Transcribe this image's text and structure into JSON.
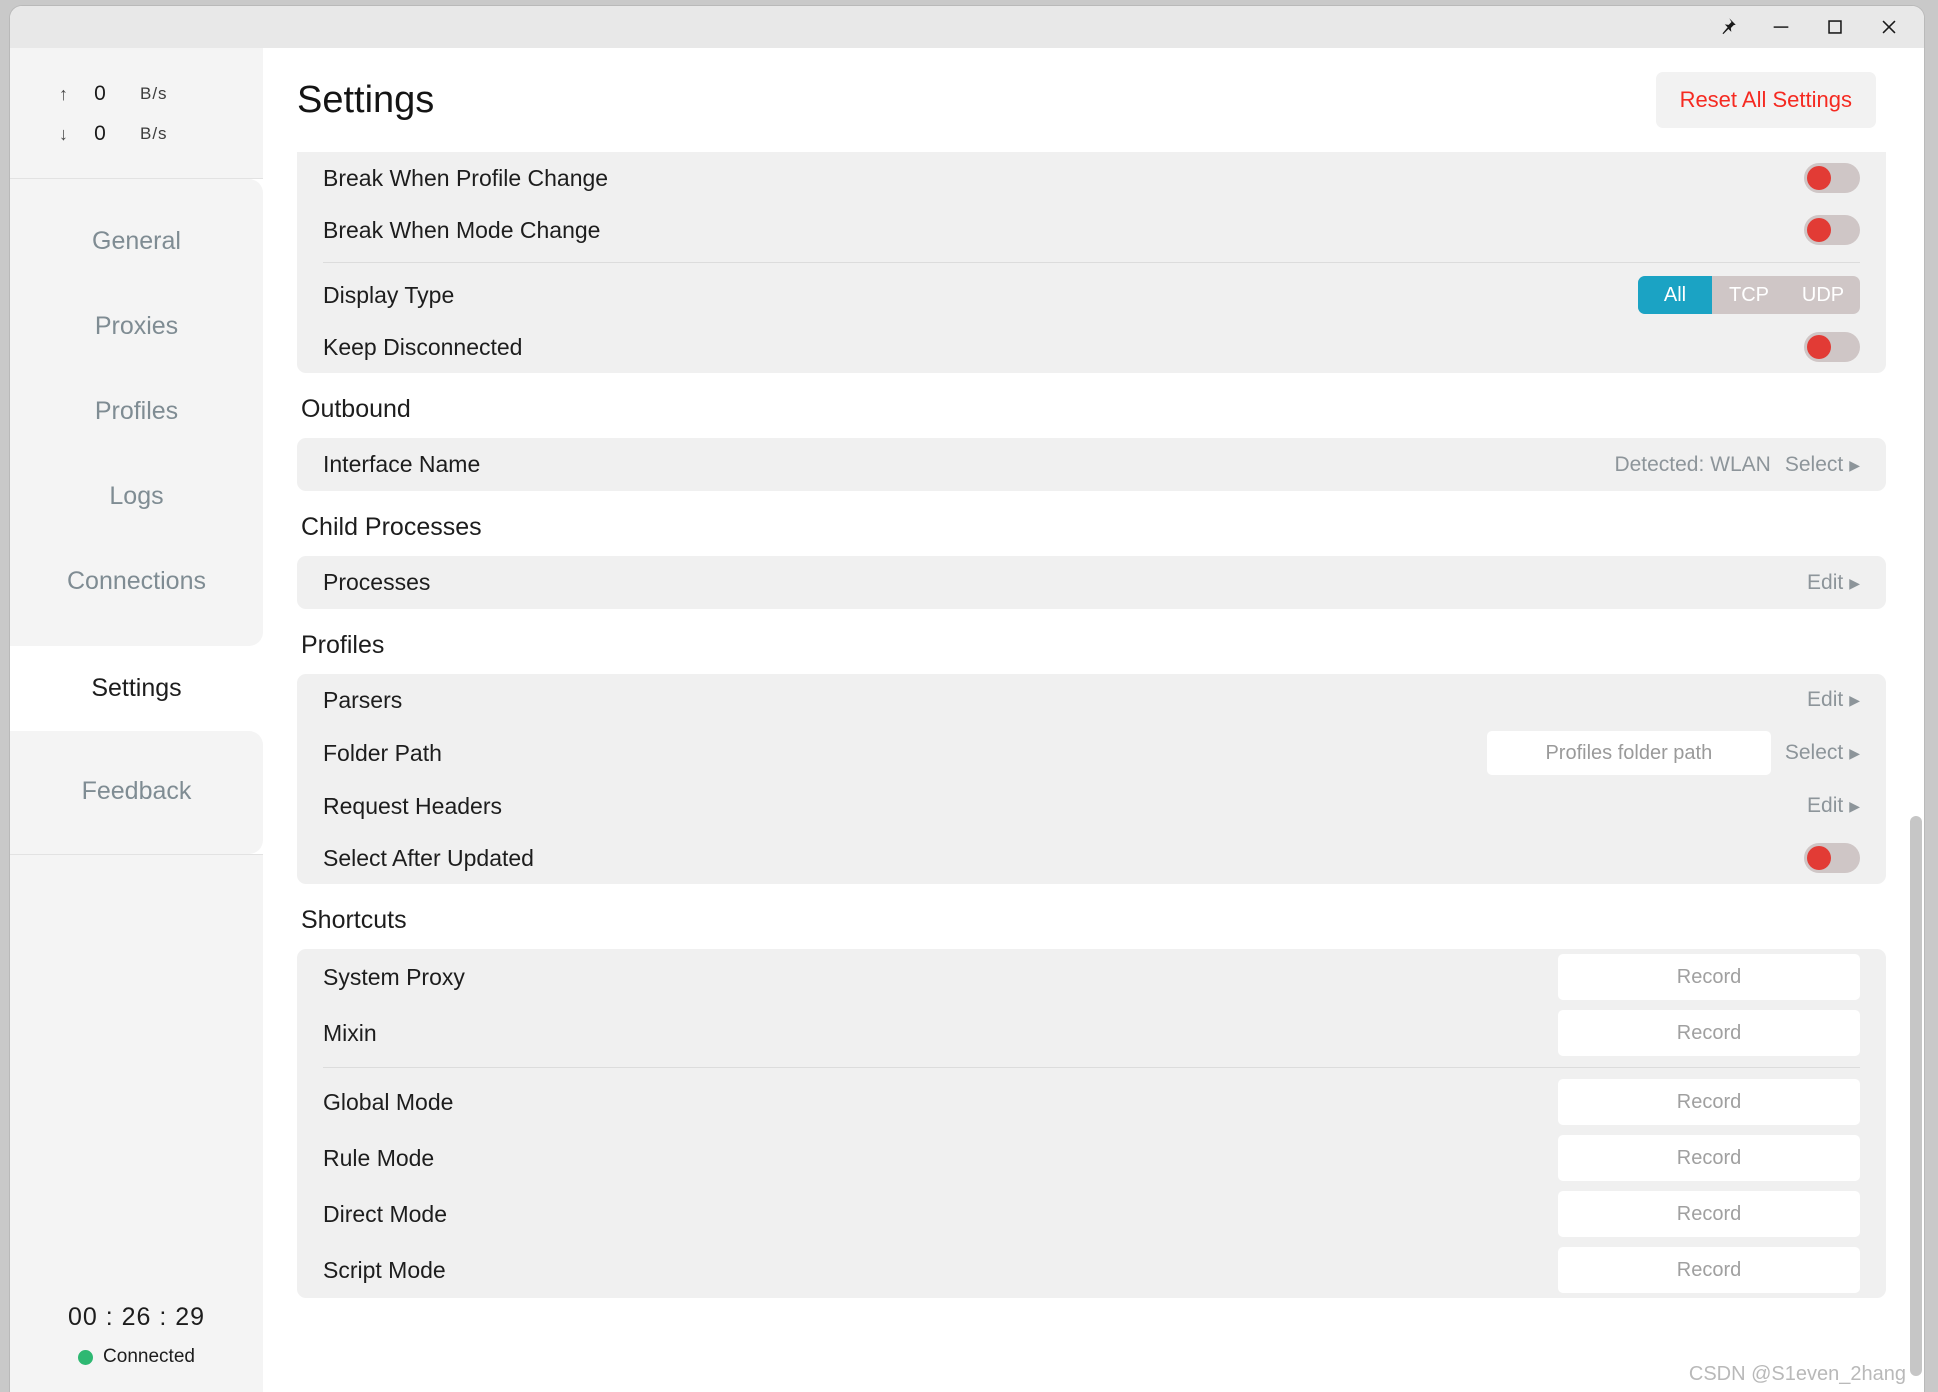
{
  "window": {
    "controls": [
      {
        "name": "pin-icon",
        "label": "Pin"
      },
      {
        "name": "minimize-icon",
        "label": "Minimize"
      },
      {
        "name": "maximize-icon",
        "label": "Maximize"
      },
      {
        "name": "close-icon",
        "label": "Close"
      }
    ]
  },
  "sidebar": {
    "traffic": {
      "upload": {
        "arrow": "↑",
        "value": "0",
        "unit": "B/s"
      },
      "download": {
        "arrow": "↓",
        "value": "0",
        "unit": "B/s"
      }
    },
    "items": [
      {
        "label": "General",
        "active": false
      },
      {
        "label": "Proxies",
        "active": false
      },
      {
        "label": "Profiles",
        "active": false
      },
      {
        "label": "Logs",
        "active": false
      },
      {
        "label": "Connections",
        "active": false
      },
      {
        "label": "Settings",
        "active": true
      },
      {
        "label": "Feedback",
        "active": false
      }
    ],
    "status": {
      "timer": "00 : 26 : 29",
      "connection_label": "Connected",
      "connection_color": "#2eb872"
    }
  },
  "header": {
    "title": "Settings",
    "reset_label": "Reset All Settings",
    "reset_color": "#f52a21"
  },
  "colors": {
    "accent": "#1ba3c4",
    "toggle_track": "#cfc6c6",
    "toggle_knob": "#e23b35",
    "card_bg": "#f0f0f0"
  },
  "sections": {
    "top_card": {
      "rows": [
        {
          "label": "Break When Profile Change",
          "control": "toggle",
          "on": false
        },
        {
          "label": "Break When Mode Change",
          "control": "toggle",
          "on": false
        },
        {
          "label": "Display Type",
          "control": "segmented",
          "options": [
            "All",
            "TCP",
            "UDP"
          ],
          "selected": "All"
        },
        {
          "label": "Keep Disconnected",
          "control": "toggle",
          "on": false
        }
      ]
    },
    "outbound": {
      "title": "Outbound",
      "rows": [
        {
          "label": "Interface Name",
          "detected": "Detected: WLAN",
          "action": "Select"
        }
      ]
    },
    "child_processes": {
      "title": "Child Processes",
      "rows": [
        {
          "label": "Processes",
          "action": "Edit"
        }
      ]
    },
    "profiles": {
      "title": "Profiles",
      "rows": [
        {
          "label": "Parsers",
          "action": "Edit"
        },
        {
          "label": "Folder Path",
          "input_placeholder": "Profiles folder path",
          "input_value": "",
          "action": "Select"
        },
        {
          "label": "Request Headers",
          "action": "Edit"
        },
        {
          "label": "Select After Updated",
          "control": "toggle",
          "on": false
        }
      ]
    },
    "shortcuts": {
      "title": "Shortcuts",
      "group_one": [
        {
          "label": "System Proxy",
          "button": "Record"
        },
        {
          "label": "Mixin",
          "button": "Record"
        }
      ],
      "group_two": [
        {
          "label": "Global Mode",
          "button": "Record"
        },
        {
          "label": "Rule Mode",
          "button": "Record"
        },
        {
          "label": "Direct Mode",
          "button": "Record"
        },
        {
          "label": "Script Mode",
          "button": "Record"
        }
      ]
    }
  },
  "watermark": "CSDN @S1even_2hang"
}
